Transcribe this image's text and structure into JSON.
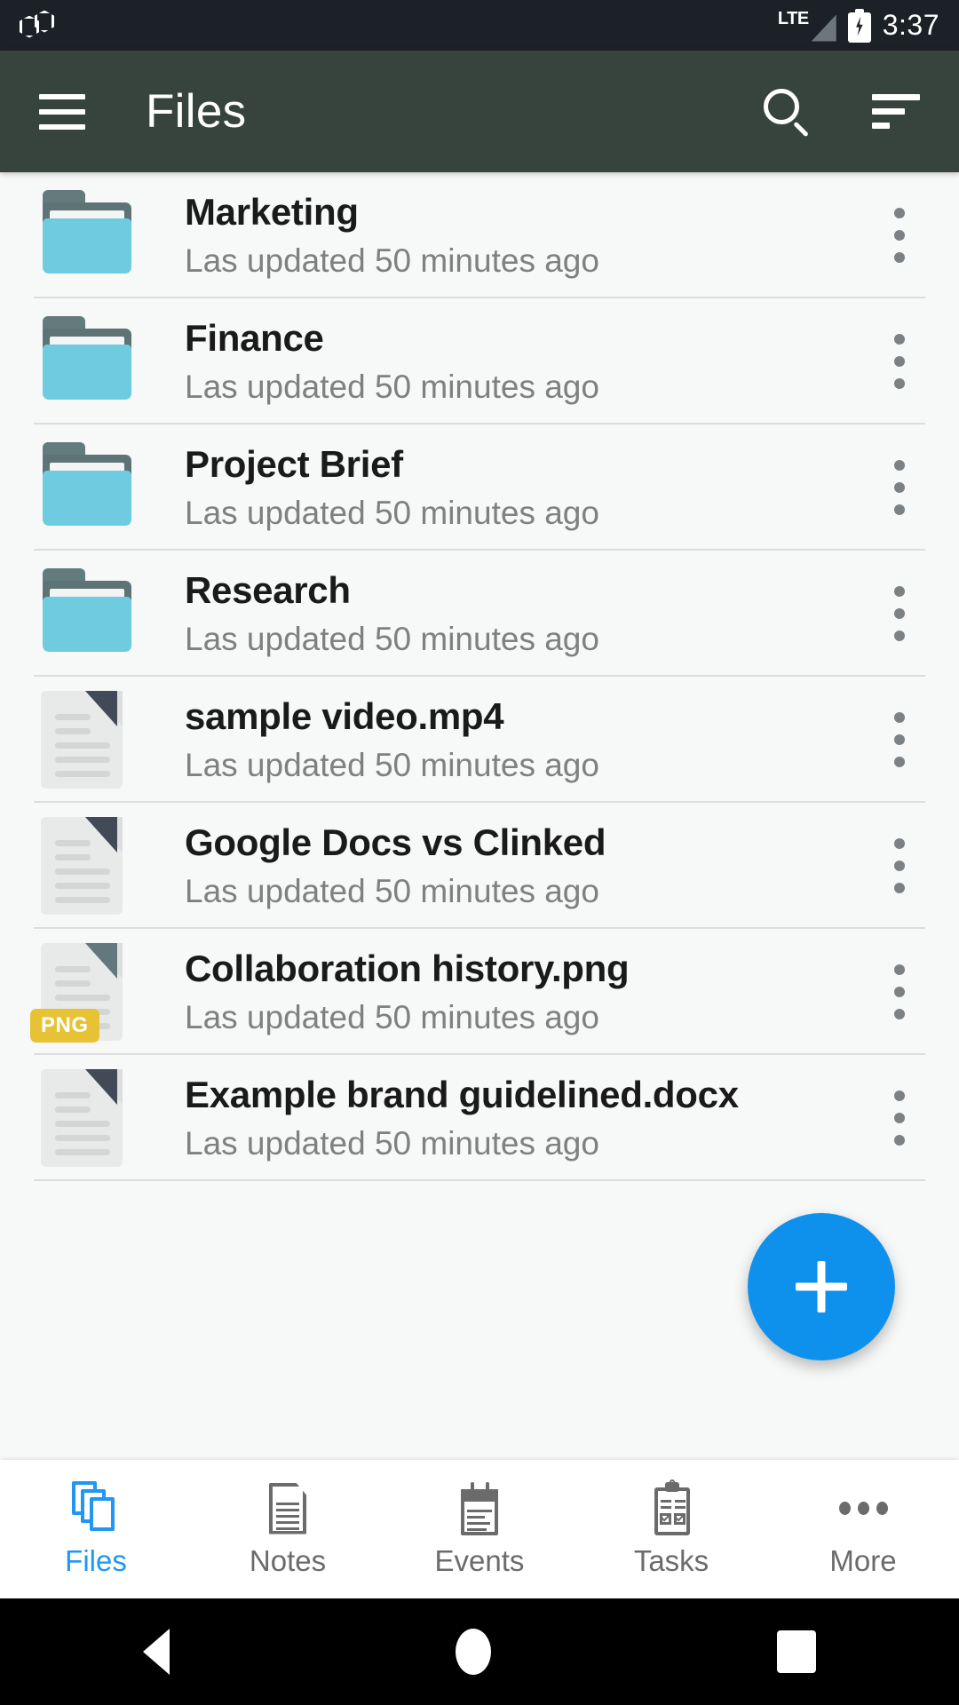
{
  "status_bar": {
    "logo_icon": "hexagon-pair-icon",
    "network_label": "LTE",
    "signal_icon": "signal-triangle-icon",
    "battery_icon": "battery-charging-icon",
    "clock": "3:37"
  },
  "app_bar": {
    "menu_icon": "hamburger-menu-icon",
    "title": "Files",
    "search_icon": "search-icon",
    "sort_icon": "sort-icon",
    "background_color": "#37443e"
  },
  "files": {
    "rows": [
      {
        "title": "Marketing",
        "subtitle": "Las updated 50 minutes ago",
        "icon": "folder-icon"
      },
      {
        "title": "Finance",
        "subtitle": "Las updated 50 minutes ago",
        "icon": "folder-icon"
      },
      {
        "title": "Project Brief",
        "subtitle": "Las updated 50 minutes ago",
        "icon": "folder-icon"
      },
      {
        "title": "Research",
        "subtitle": "Las updated 50 minutes ago",
        "icon": "folder-icon"
      },
      {
        "title": "sample video.mp4",
        "subtitle": "Las updated 50 minutes ago",
        "icon": "document-icon"
      },
      {
        "title": "Google Docs vs Clinked",
        "subtitle": "Las updated 50 minutes ago",
        "icon": "document-icon"
      },
      {
        "title": "Collaboration history.png",
        "subtitle": "Las updated 50 minutes ago",
        "icon": "png-file-icon",
        "badge": "PNG"
      },
      {
        "title": "Example brand guidelined.docx",
        "subtitle": "Las updated 50 minutes ago",
        "icon": "document-icon"
      }
    ],
    "overflow_icon": "more-vertical-icon",
    "folder_color": "#6ecbe0",
    "badge_color": "#e8c235"
  },
  "fab": {
    "icon": "plus-icon",
    "color": "#0e91ec"
  },
  "bottom_nav": {
    "active_color": "#2196f3",
    "items": [
      {
        "label": "Files",
        "icon": "files-stack-icon"
      },
      {
        "label": "Notes",
        "icon": "note-document-icon"
      },
      {
        "label": "Events",
        "icon": "calendar-icon"
      },
      {
        "label": "Tasks",
        "icon": "clipboard-checklist-icon"
      },
      {
        "label": "More",
        "icon": "more-horizontal-icon"
      }
    ]
  },
  "android_nav": {
    "back_icon": "back-triangle-icon",
    "home_icon": "home-circle-icon",
    "recents_icon": "recents-square-icon"
  }
}
